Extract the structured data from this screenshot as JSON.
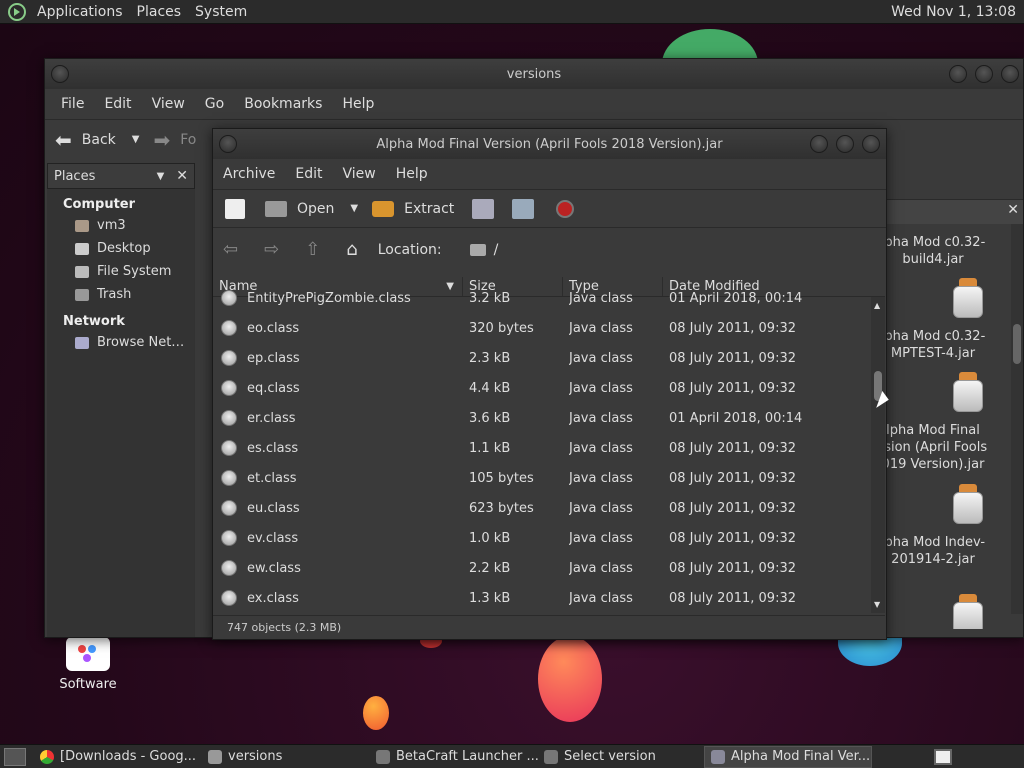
{
  "topbar": {
    "menus": [
      "Applications",
      "Places",
      "System"
    ],
    "clock": "Wed Nov 1, 13:08"
  },
  "desktop": {
    "software_label": "Software"
  },
  "versions_window": {
    "title": "versions",
    "menus": [
      "File",
      "Edit",
      "View",
      "Go",
      "Bookmarks",
      "Help"
    ],
    "back_label": "Back",
    "forward_label": "Fo",
    "places_label": "Places",
    "sections": {
      "computer": "Computer",
      "network": "Network"
    },
    "computer_items": [
      "vm3",
      "Desktop",
      "File System",
      "Trash"
    ],
    "network_items": [
      "Browse Net…"
    ],
    "icons": [
      {
        "label": "lpha Mod c0.32-\nbuild4.jar"
      },
      {
        "label": "lpha Mod c0.32-\nMPTEST-4.jar"
      },
      {
        "label": "lpha Mod Final\nrsion (April Fools\n019 Version).jar"
      },
      {
        "label": "lpha Mod Indev-\n201914-2.jar"
      }
    ]
  },
  "archive_window": {
    "title": "Alpha Mod Final Version (April Fools 2018 Version).jar",
    "menus": [
      "Archive",
      "Edit",
      "View",
      "Help"
    ],
    "toolbar": {
      "open_label": "Open",
      "extract_label": "Extract"
    },
    "location_label": "Location:",
    "location_value": "/",
    "columns": [
      "Name",
      "Size",
      "Type",
      "Date Modified"
    ],
    "rows": [
      {
        "name": "EntityPrePigZombie.class",
        "size": "3.2 kB",
        "type": "Java class",
        "date": "01 April 2018, 00:14"
      },
      {
        "name": "eo.class",
        "size": "320 bytes",
        "type": "Java class",
        "date": "08 July 2011, 09:32"
      },
      {
        "name": "ep.class",
        "size": "2.3 kB",
        "type": "Java class",
        "date": "08 July 2011, 09:32"
      },
      {
        "name": "eq.class",
        "size": "4.4 kB",
        "type": "Java class",
        "date": "08 July 2011, 09:32"
      },
      {
        "name": "er.class",
        "size": "3.6 kB",
        "type": "Java class",
        "date": "01 April 2018, 00:14"
      },
      {
        "name": "es.class",
        "size": "1.1 kB",
        "type": "Java class",
        "date": "08 July 2011, 09:32"
      },
      {
        "name": "et.class",
        "size": "105 bytes",
        "type": "Java class",
        "date": "08 July 2011, 09:32"
      },
      {
        "name": "eu.class",
        "size": "623 bytes",
        "type": "Java class",
        "date": "08 July 2011, 09:32"
      },
      {
        "name": "ev.class",
        "size": "1.0 kB",
        "type": "Java class",
        "date": "08 July 2011, 09:32"
      },
      {
        "name": "ew.class",
        "size": "2.2 kB",
        "type": "Java class",
        "date": "08 July 2011, 09:32"
      },
      {
        "name": "ex.class",
        "size": "1.3 kB",
        "type": "Java class",
        "date": "08 July 2011, 09:32"
      }
    ],
    "status": "747 objects (2.3 MB)"
  },
  "taskbar": {
    "tasks": [
      "[Downloads - Goog...",
      "versions",
      "BetaCraft Launcher ...",
      "Select version",
      "Alpha Mod Final Ver..."
    ]
  }
}
